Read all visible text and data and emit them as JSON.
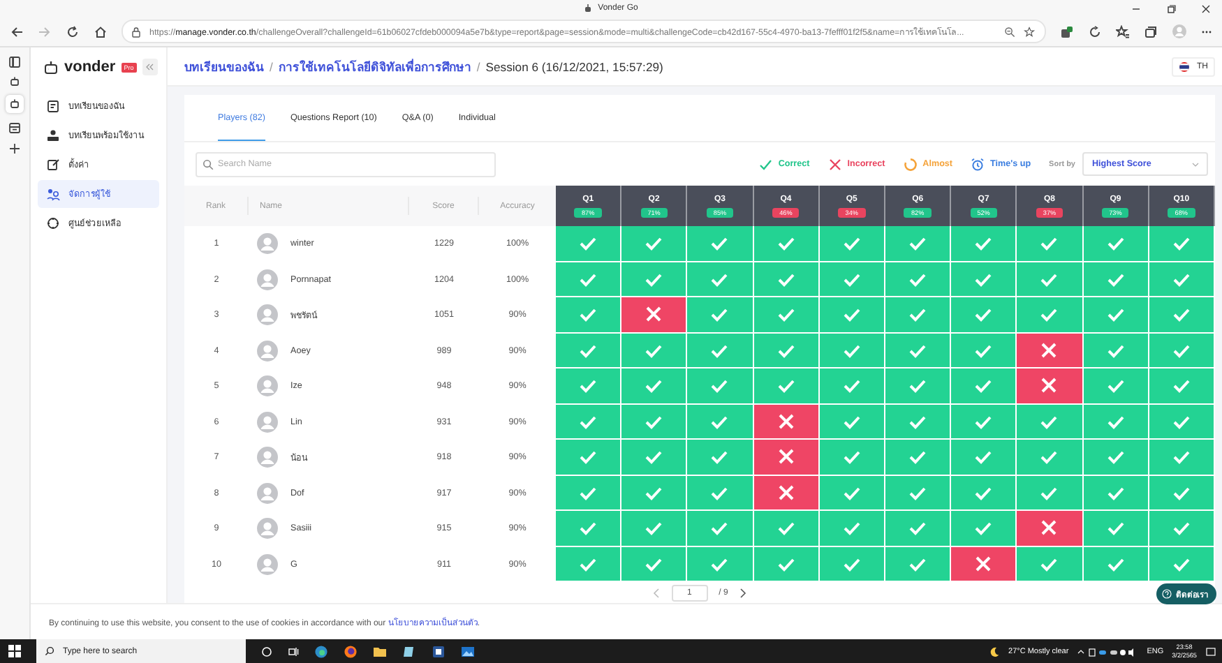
{
  "browser": {
    "title": "Vonder Go",
    "url_scheme": "https://",
    "url_host": "manage.vonder.co.th",
    "url_rest": "/challengeOverall?challengeId=61b06027cfdeb000094a5e7b&type=report&page=session&mode=multi&challengeCode=cb42d167-55c4-4970-ba13-7fefff01f2f5&name=การใช้เทคโนโล..."
  },
  "sidebar": {
    "logo": "vonder",
    "badge": "Pro",
    "items": [
      {
        "label": "บทเรียนของฉัน",
        "selected": false
      },
      {
        "label": "บทเรียนพร้อมใช้งาน",
        "selected": false
      },
      {
        "label": "ตั้งค่า",
        "selected": false
      },
      {
        "label": "จัดการผู้ใช้",
        "selected": true
      },
      {
        "label": "ศูนย์ช่วยเหลือ",
        "selected": false
      }
    ]
  },
  "breadcrumb": [
    {
      "label": "บทเรียนของฉัน",
      "kind": "link"
    },
    {
      "label": "/",
      "kind": "separator"
    },
    {
      "label": "การใช้เทคโนโลยีดิจิทัลเพื่อการศึกษา",
      "kind": "link"
    },
    {
      "label": "/",
      "kind": "separator"
    },
    {
      "label": "Session 6 (16/12/2021, 15:57:29)",
      "kind": "current"
    }
  ],
  "language": "TH",
  "tabs": [
    {
      "label": "Players (82)",
      "selected": true
    },
    {
      "label": "Questions Report (10)",
      "selected": false
    },
    {
      "label": "Q&A (0)",
      "selected": false
    },
    {
      "label": "Individual",
      "selected": false
    }
  ],
  "search": {
    "placeholder": "Search Name"
  },
  "legend": [
    {
      "label": "Correct",
      "kind": "correct"
    },
    {
      "label": "Incorrect",
      "kind": "incorrect"
    },
    {
      "label": "Almost",
      "kind": "almost"
    },
    {
      "label": "Time's up",
      "kind": "timeup"
    }
  ],
  "sort": {
    "label": "Sort by",
    "value": "Highest Score"
  },
  "table": {
    "columns": [
      "Rank",
      "Name",
      "Score",
      "Accuracy"
    ],
    "questions": [
      {
        "label": "Q1",
        "percent": "87%",
        "color": "#21c58b"
      },
      {
        "label": "Q2",
        "percent": "71%",
        "color": "#21c58b"
      },
      {
        "label": "Q3",
        "percent": "85%",
        "color": "#21c58b"
      },
      {
        "label": "Q4",
        "percent": "46%",
        "color": "#e9445f"
      },
      {
        "label": "Q5",
        "percent": "34%",
        "color": "#e9445f"
      },
      {
        "label": "Q6",
        "percent": "82%",
        "color": "#21c58b"
      },
      {
        "label": "Q7",
        "percent": "52%",
        "color": "#21c58b"
      },
      {
        "label": "Q8",
        "percent": "37%",
        "color": "#e9445f"
      },
      {
        "label": "Q9",
        "percent": "73%",
        "color": "#21c58b"
      },
      {
        "label": "Q10",
        "percent": "68%",
        "color": "#21c58b"
      }
    ],
    "rows": [
      {
        "rank": "1",
        "name": "winter",
        "score": "1229",
        "accuracy": "100%",
        "correct": [
          true,
          true,
          true,
          true,
          true,
          true,
          true,
          true,
          true,
          true
        ]
      },
      {
        "rank": "2",
        "name": "Pornnapat",
        "score": "1204",
        "accuracy": "100%",
        "correct": [
          true,
          true,
          true,
          true,
          true,
          true,
          true,
          true,
          true,
          true
        ]
      },
      {
        "rank": "3",
        "name": "พชรัตน์",
        "score": "1051",
        "accuracy": "90%",
        "correct": [
          true,
          false,
          true,
          true,
          true,
          true,
          true,
          true,
          true,
          true
        ]
      },
      {
        "rank": "4",
        "name": "Aoey",
        "score": "989",
        "accuracy": "90%",
        "correct": [
          true,
          true,
          true,
          true,
          true,
          true,
          true,
          false,
          true,
          true
        ]
      },
      {
        "rank": "5",
        "name": "Ize",
        "score": "948",
        "accuracy": "90%",
        "correct": [
          true,
          true,
          true,
          true,
          true,
          true,
          true,
          false,
          true,
          true
        ]
      },
      {
        "rank": "6",
        "name": "Lin",
        "score": "931",
        "accuracy": "90%",
        "correct": [
          true,
          true,
          true,
          false,
          true,
          true,
          true,
          true,
          true,
          true
        ]
      },
      {
        "rank": "7",
        "name": "น้อน",
        "score": "918",
        "accuracy": "90%",
        "correct": [
          true,
          true,
          true,
          false,
          true,
          true,
          true,
          true,
          true,
          true
        ]
      },
      {
        "rank": "8",
        "name": "Dof",
        "score": "917",
        "accuracy": "90%",
        "correct": [
          true,
          true,
          true,
          false,
          true,
          true,
          true,
          true,
          true,
          true
        ]
      },
      {
        "rank": "9",
        "name": "Sasiii",
        "score": "915",
        "accuracy": "90%",
        "correct": [
          true,
          true,
          true,
          true,
          true,
          true,
          true,
          false,
          true,
          true
        ]
      },
      {
        "rank": "10",
        "name": "G",
        "score": "911",
        "accuracy": "90%",
        "correct": [
          true,
          true,
          true,
          true,
          true,
          true,
          false,
          true,
          true,
          true
        ]
      }
    ]
  },
  "pagination": {
    "page": "1",
    "total": "/ 9"
  },
  "contact": "ติดต่อเรา",
  "cookie": {
    "text": "By continuing to use this website, you consent to the use of cookies in accordance with our",
    "link": "นโยบายความเป็นส่วนตัว",
    "end": "."
  },
  "taskbar": {
    "search_placeholder": "Type here to search",
    "weather": "27°C  Mostly clear",
    "language": "ENG",
    "time": "23:58",
    "date": "3/2/2565"
  }
}
